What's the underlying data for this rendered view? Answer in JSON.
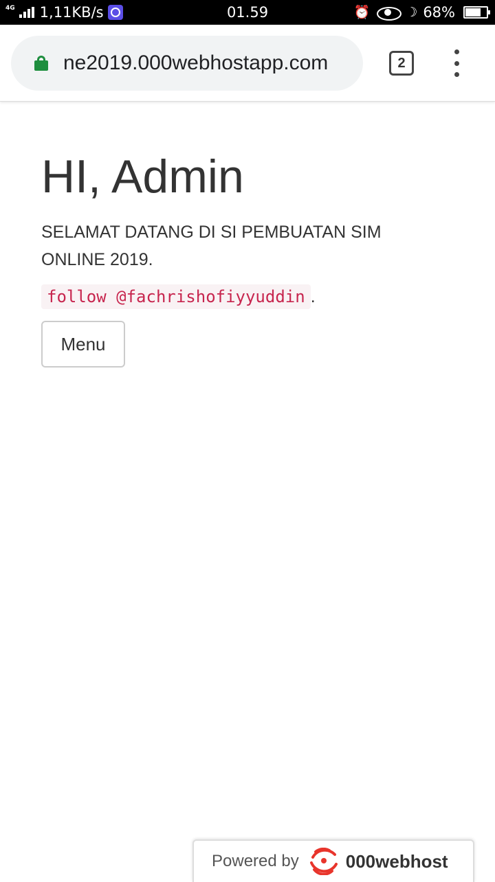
{
  "status_bar": {
    "network": "4G",
    "speed": "1,11KB/s",
    "time": "01.59",
    "battery_percent": "68%",
    "battery_level": 0.68,
    "icons": [
      "signal-icon",
      "vpn-icon",
      "alarm-icon",
      "eye-icon",
      "moon-icon",
      "battery-icon"
    ]
  },
  "browser": {
    "url": "ne2019.000webhostapp.com",
    "tab_count": "2",
    "icons": [
      "lock-icon",
      "tab-switcher-icon",
      "more-options-icon"
    ],
    "lock_color": "#1e8e3e"
  },
  "page": {
    "title": "HI, Admin",
    "intro": "SELAMAT DATANG DI SI PEMBUATAN SIM ONLINE 2019.",
    "follow_code": "follow @fachrishofiyyuddin",
    "follow_suffix": ".",
    "menu_button": "Menu",
    "code_color": "#c7254e"
  },
  "footer": {
    "powered_by": "Powered by",
    "brand": "000webhost",
    "brand_color": "#e8352c"
  }
}
